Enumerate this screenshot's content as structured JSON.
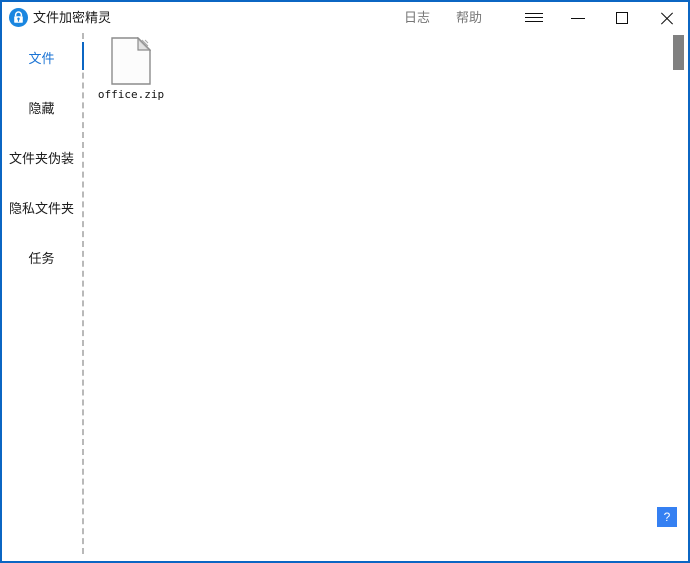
{
  "window": {
    "title": "文件加密精灵",
    "app_icon": "lock-circle-icon",
    "border_color": "#0b66c3"
  },
  "titlebar": {
    "menu": [
      {
        "label": "日志",
        "name": "log"
      },
      {
        "label": "帮助",
        "name": "help"
      }
    ],
    "controls": [
      {
        "name": "menu-hamburger",
        "icon": "hamburger-icon"
      },
      {
        "name": "minimize",
        "icon": "minimize-icon"
      },
      {
        "name": "maximize",
        "icon": "maximize-icon"
      },
      {
        "name": "close",
        "icon": "close-icon"
      }
    ]
  },
  "sidebar": {
    "active_index": 0,
    "active_color": "#1a73d4",
    "items": [
      {
        "label": "文件"
      },
      {
        "label": "隐藏"
      },
      {
        "label": "文件夹伪装"
      },
      {
        "label": "隐私文件夹"
      },
      {
        "label": "任务"
      }
    ]
  },
  "content": {
    "files": [
      {
        "name": "office.zip",
        "icon": "generic-document-icon"
      }
    ]
  },
  "scrollbar": {
    "thumb_color": "#808080"
  },
  "help_button": {
    "label": "?",
    "color": "#3580f2"
  }
}
